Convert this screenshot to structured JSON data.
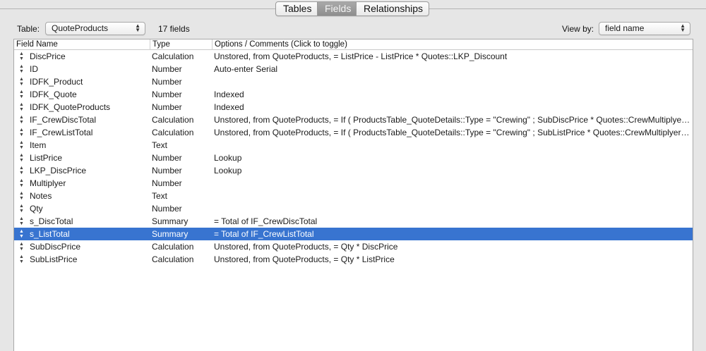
{
  "tabs": [
    {
      "label": "Tables",
      "active": false
    },
    {
      "label": "Fields",
      "active": true
    },
    {
      "label": "Relationships",
      "active": false
    }
  ],
  "controls": {
    "table_label": "Table:",
    "table_value": "QuoteProducts",
    "field_count": "17 fields",
    "viewby_label": "View by:",
    "viewby_value": "field name"
  },
  "columns": {
    "name": "Field Name",
    "type": "Type",
    "options": "Options / Comments   (Click to toggle)"
  },
  "colors": {
    "selection": "#3874d0",
    "active_tab": "#9c9c9c"
  },
  "selected_index": 14,
  "fields": [
    {
      "name": "DiscPrice",
      "type": "Calculation",
      "options": "Unstored, from QuoteProducts, = ListPrice - ListPrice * Quotes::LKP_Discount"
    },
    {
      "name": "ID",
      "type": "Number",
      "options": "Auto-enter Serial"
    },
    {
      "name": "IDFK_Product",
      "type": "Number",
      "options": ""
    },
    {
      "name": "IDFK_Quote",
      "type": "Number",
      "options": "Indexed"
    },
    {
      "name": "IDFK_QuoteProducts",
      "type": "Number",
      "options": "Indexed"
    },
    {
      "name": "IF_CrewDiscTotal",
      "type": "Calculation",
      "options": "Unstored, from QuoteProducts, = If (  ProductsTable_QuoteDetails::Type = \"Crewing\" ;   SubDiscPrice * Quotes::CrewMultiplyer ;  Su..."
    },
    {
      "name": "IF_CrewListTotal",
      "type": "Calculation",
      "options": "Unstored, from QuoteProducts, = If (  ProductsTable_QuoteDetails::Type = \"Crewing\" ;   SubListPrice * Quotes::CrewMultiplyer ;  Su..."
    },
    {
      "name": "Item",
      "type": "Text",
      "options": ""
    },
    {
      "name": "ListPrice",
      "type": "Number",
      "options": "Lookup"
    },
    {
      "name": "LKP_DiscPrice",
      "type": "Number",
      "options": "Lookup"
    },
    {
      "name": "Multiplyer",
      "type": "Number",
      "options": ""
    },
    {
      "name": "Notes",
      "type": "Text",
      "options": ""
    },
    {
      "name": "Qty",
      "type": "Number",
      "options": ""
    },
    {
      "name": "s_DiscTotal",
      "type": "Summary",
      "options": "= Total of IF_CrewDiscTotal"
    },
    {
      "name": "s_ListTotal",
      "type": "Summary",
      "options": "= Total of IF_CrewListTotal"
    },
    {
      "name": "SubDiscPrice",
      "type": "Calculation",
      "options": "Unstored, from QuoteProducts, = Qty * DiscPrice"
    },
    {
      "name": "SubListPrice",
      "type": "Calculation",
      "options": "Unstored, from QuoteProducts, = Qty * ListPrice"
    }
  ]
}
